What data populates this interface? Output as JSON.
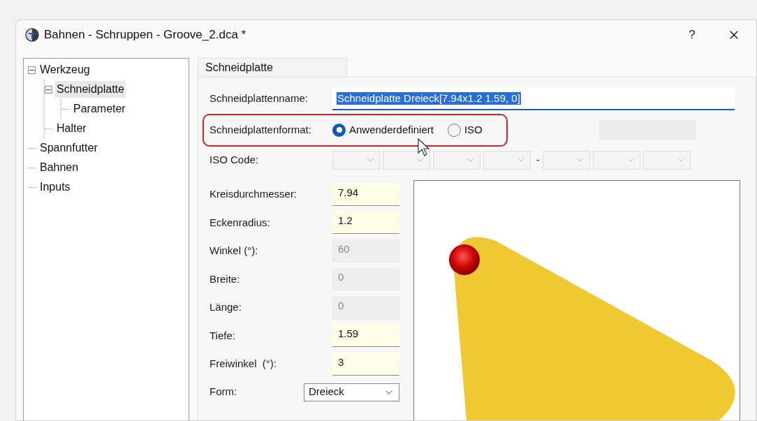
{
  "window": {
    "title": "Bahnen - Schruppen - Groove_2.dca *",
    "help": "?"
  },
  "tree": [
    {
      "label": "Werkzeug",
      "expanded": true,
      "selected": false,
      "children": [
        {
          "label": "Schneidplatte",
          "expanded": true,
          "selected": true,
          "children": [
            {
              "label": "Parameter",
              "selected": false
            }
          ]
        },
        {
          "label": "Halter",
          "selected": false
        }
      ]
    },
    {
      "label": "Spannfutter",
      "selected": false
    },
    {
      "label": "Bahnen",
      "selected": false
    },
    {
      "label": "Inputs",
      "selected": false
    }
  ],
  "tabs": [
    {
      "label": "Schneidplatte",
      "selected": true
    }
  ],
  "name_field": {
    "label": "Schneidplattenname:",
    "value": "Schneidplatte Dreieck[7.94x1.2 1.59, 0]"
  },
  "format": {
    "label": "Schneidplattenformat:",
    "options": [
      {
        "label": "Anwenderdefiniert",
        "selected": true
      },
      {
        "label": "ISO",
        "selected": false
      }
    ]
  },
  "iso_code": {
    "label": "ISO Code:",
    "separator": "-",
    "groups": [
      [
        {
          "disabled": true
        },
        {
          "disabled": true
        },
        {
          "disabled": true
        },
        {
          "disabled": true
        }
      ],
      [
        {
          "disabled": true
        },
        {
          "disabled": true
        },
        {
          "disabled": true
        }
      ]
    ]
  },
  "params": [
    {
      "label": "Kreisdurchmesser:",
      "value": "7.94",
      "disabled": false
    },
    {
      "label": "Eckenradius:",
      "value": "1.2",
      "disabled": false
    },
    {
      "label": "Winkel (°):",
      "value": "60",
      "disabled": true
    },
    {
      "label": "Breite:",
      "value": "0",
      "disabled": true
    },
    {
      "label": "Länge:",
      "value": "0",
      "disabled": true
    },
    {
      "label": "Tiefe:",
      "value": "1.59",
      "disabled": false
    },
    {
      "label": "Freiwinkel  (°):",
      "value": "3",
      "disabled": false
    }
  ],
  "form": {
    "label": "Form:",
    "value": "Dreieck"
  }
}
